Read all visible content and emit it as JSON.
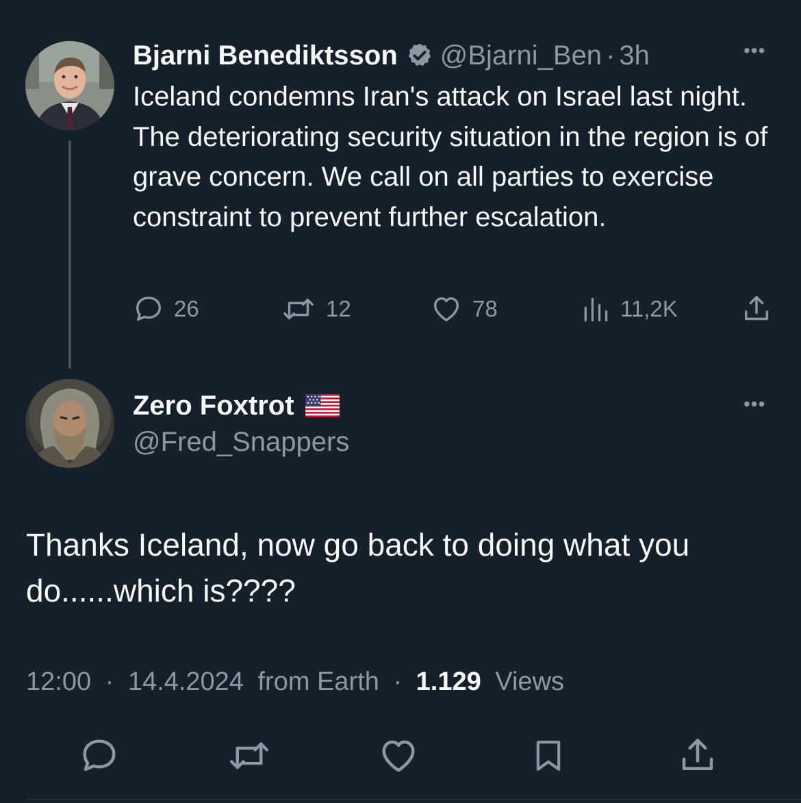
{
  "parent_tweet": {
    "author_name": "Bjarni Benediktsson",
    "verified": true,
    "handle": "@Bjarni_Ben",
    "separator": "·",
    "time": "3h",
    "more_label": "•••",
    "text": "Iceland condemns Iran's attack on Israel last night. The deteriorating security situation in the region is of grave concern. We call on all parties to exercise constraint to prevent further escalation.",
    "actions": {
      "replies": "26",
      "reposts": "12",
      "likes": "78",
      "views": "11,2K"
    }
  },
  "reply_tweet": {
    "author_name": "Zero Foxtrot",
    "flag": "🇺🇸",
    "handle": "@Fred_Snappers",
    "more_label": "•••",
    "text": "Thanks Iceland, now go back to doing what you do......which is????",
    "time": "12:00",
    "date": "14.4.2024",
    "source": "from Earth",
    "separator": "·",
    "views_count": "1.129",
    "views_label": "Views"
  },
  "icons": {
    "reply": "speech-bubble-icon",
    "repost": "repost-arrows-icon",
    "like": "heart-icon",
    "views": "bar-chart-icon",
    "share": "share-upload-icon",
    "bookmark": "bookmark-icon",
    "verified": "verified-badge-icon"
  },
  "colors": {
    "background": "#15202b",
    "primary_text": "#f7f9f9",
    "secondary_text": "#8b98a5",
    "thread_line": "#425364"
  }
}
